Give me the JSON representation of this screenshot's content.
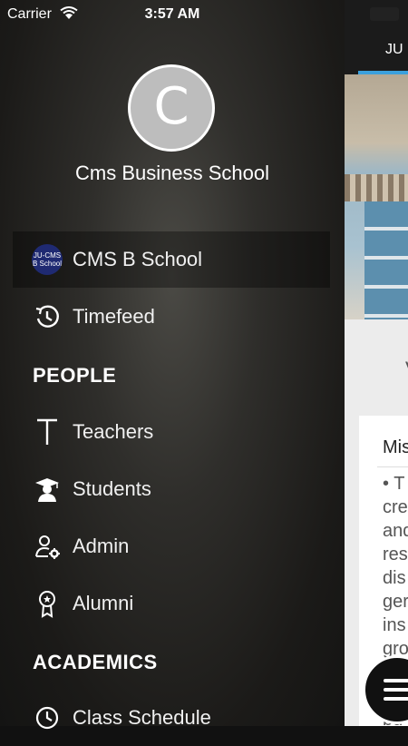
{
  "status_bar": {
    "carrier": "Carrier",
    "time": "3:57 AM"
  },
  "drawer": {
    "avatar_initial": "C",
    "school_name": "Cms Business School",
    "items": [
      {
        "label": "CMS B School",
        "icon": "school-logo-icon",
        "logo_text_1": "JU-CMS",
        "logo_text_2": "B School"
      },
      {
        "label": "Timefeed",
        "icon": "timefeed-icon"
      }
    ],
    "sections": [
      {
        "title": "PEOPLE",
        "items": [
          {
            "label": "Teachers",
            "icon": "teachers-icon"
          },
          {
            "label": "Students",
            "icon": "graduate-icon"
          },
          {
            "label": "Admin",
            "icon": "admin-icon"
          },
          {
            "label": "Alumni",
            "icon": "alumni-badge-icon"
          }
        ]
      },
      {
        "title": "ACADEMICS",
        "items": [
          {
            "label": "Class Schedule",
            "icon": "class-schedule-icon"
          }
        ]
      }
    ]
  },
  "content": {
    "tab_label": "JU",
    "partial_text": "V",
    "card_heading": "Mis",
    "card_body": "• T\ncre\nand\nres\ndis\nger\nins\ngro\nM\nan\nbu",
    "accent_color": "#3ba0dc"
  }
}
